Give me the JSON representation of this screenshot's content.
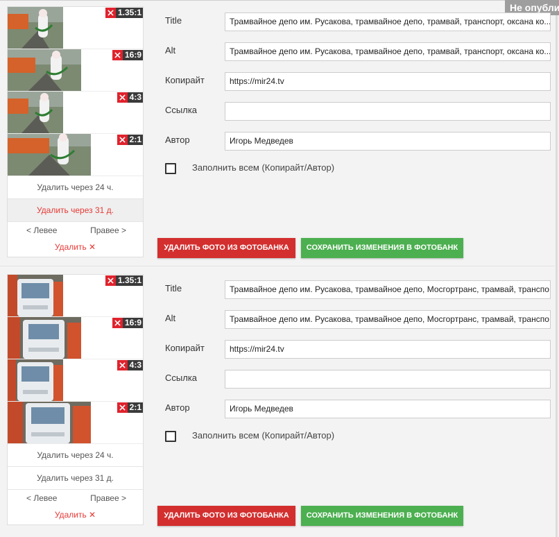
{
  "status_badge": "Не опубликовано",
  "colors": {
    "delete": "#d32f2f",
    "save": "#4caf50",
    "x": "#e0232d",
    "accent_red": "#e53935"
  },
  "icons": {
    "crop_close": "close-icon",
    "remove": "close-icon"
  },
  "form_labels": {
    "title": "Title",
    "alt": "Alt",
    "copyright": "Копирайт",
    "link": "Ссылка",
    "author": "Автор",
    "fill_all": "Заполнить всем (Копирайт/Автор)"
  },
  "entries": [
    {
      "crops": [
        "1.35:1",
        "16:9",
        "4:3",
        "2:1"
      ],
      "delete_24": "Удалить через 24 ч.",
      "delete_31": "Удалить через 31 д.",
      "left_nav": "< Левее",
      "right_nav": "Правее >",
      "remove": "Удалить",
      "title": "Трамвайное депо им. Русакова, трамвайное депо, трамвай, транспорт, оксана ко...",
      "alt": "Трамвайное депо им. Русакова, трамвайное депо, трамвай, транспорт, оксана ко...",
      "copyright": "https://mir24.tv",
      "link": "",
      "author": "Игорь Медведев",
      "fill_all_checked": false,
      "btn_delete": "УДАЛИТЬ ФОТО ИЗ ФОТОБАНКА",
      "btn_save": "СОХРАНИТЬ ИЗМЕНЕНИЯ В ФОТОБАНК"
    },
    {
      "crops": [
        "1.35:1",
        "16:9",
        "4:3",
        "2:1"
      ],
      "delete_24": "Удалить через 24 ч.",
      "delete_31": "Удалить через 31 д.",
      "left_nav": "< Левее",
      "right_nav": "Правее >",
      "remove": "Удалить",
      "title": "Трамвайное депо им. Русакова, трамвайное депо, Мосгортранс, трамвай, транспо...",
      "alt": "Трамвайное депо им. Русакова, трамвайное депо, Мосгортранс, трамвай, транспо...",
      "copyright": "https://mir24.tv",
      "link": "",
      "author": "Игорь Медведев",
      "fill_all_checked": false,
      "btn_delete": "УДАЛИТЬ ФОТО ИЗ ФОТОБАНКА",
      "btn_save": "СОХРАНИТЬ ИЗМЕНЕНИЯ В ФОТОБАНК"
    }
  ]
}
